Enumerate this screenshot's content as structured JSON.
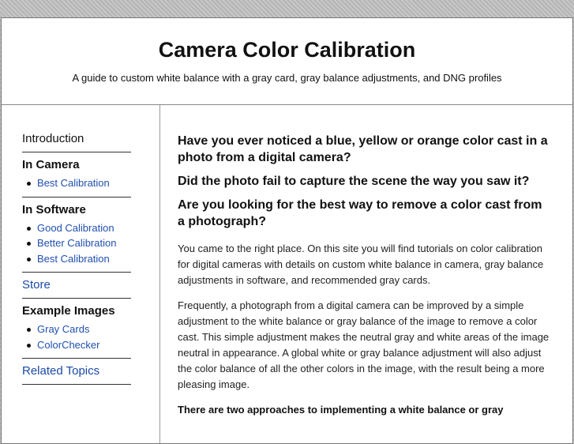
{
  "header": {
    "title": "Camera Color Calibration",
    "tagline": "A guide to custom white balance with a gray card, gray balance adjustments, and DNG profiles"
  },
  "sidebar": {
    "introduction": "Introduction",
    "in_camera": {
      "heading": "In Camera",
      "items": [
        "Best Calibration"
      ]
    },
    "in_software": {
      "heading": "In Software",
      "items": [
        "Good Calibration",
        "Better Calibration",
        "Best Calibration"
      ]
    },
    "store": "Store",
    "example_images": {
      "heading": "Example Images",
      "items": [
        "Gray Cards",
        "ColorChecker"
      ]
    },
    "related_topics": "Related Topics"
  },
  "main": {
    "questions": [
      "Have you ever noticed a blue, yellow or orange color cast in a photo from a digital camera?",
      "Did the photo fail to capture the scene the way you saw it?",
      "Are you looking for the best way to remove a color cast from a photograph?"
    ],
    "paragraphs": [
      "You came to the right place. On this site you will find tutorials on color calibration for digital cameras with details on custom white balance in camera, gray balance adjustments in software, and recommended gray cards.",
      "Frequently, a photograph from a digital camera can be improved by a simple adjustment to the white balance or gray balance of the image to remove a color cast. This simple adjustment makes the neutral gray and white areas of the image neutral in appearance. A global white or gray balance adjustment will also adjust the color balance of all the other colors in the image, with the result being a more pleasing image."
    ],
    "bold_lead": "There are two approaches to implementing a white balance or gray"
  }
}
